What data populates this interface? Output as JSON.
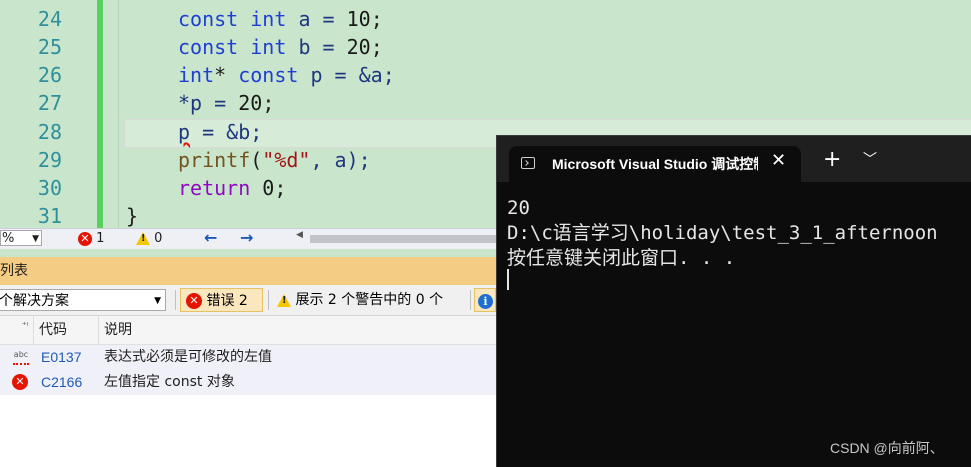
{
  "editor": {
    "lines": [
      {
        "no": "24"
      },
      {
        "no": "25"
      },
      {
        "no": "26"
      },
      {
        "no": "27"
      },
      {
        "no": "28"
      },
      {
        "no": "29"
      },
      {
        "no": "30"
      },
      {
        "no": "31"
      }
    ],
    "tokens": {
      "l24": [
        "const",
        "int",
        "a = ",
        "10",
        ";"
      ],
      "l25": [
        "const",
        "int",
        "b = ",
        "20",
        ";"
      ],
      "l26": [
        "int",
        "* ",
        "const",
        " p = &a;"
      ],
      "l27": [
        "*p = ",
        "20",
        ";"
      ],
      "l28": [
        "p",
        " = &b;"
      ],
      "l29": [
        "printf",
        "(",
        "\"%d\"",
        ", a);"
      ],
      "l30": [
        "return",
        " ",
        "0",
        ";"
      ],
      "l31": [
        "}"
      ]
    }
  },
  "status": {
    "zoom": "%",
    "errors": "1",
    "warnings": "0",
    "back_arrow": "←",
    "forward_arrow": "→"
  },
  "error_list": {
    "title": "吴列表",
    "scope": "个解决方案",
    "errors_button": "错误 2",
    "warnings_button": "展示 2 个警告中的 0 个",
    "columns": {
      "code": "代码",
      "desc": "说明"
    },
    "rows": [
      {
        "code": "E0137",
        "desc": "表达式必须是可修改的左值",
        "icon": "spell-error-icon"
      },
      {
        "code": "C2166",
        "desc": "左值指定 const 对象",
        "icon": "error-icon"
      }
    ]
  },
  "console": {
    "tab_title": "Microsoft Visual Studio 调试控制台",
    "output": [
      "20",
      "D:\\c语言学习\\holiday\\test_3_1_afternoon",
      "按任意键关闭此窗口. . ."
    ]
  },
  "watermark": "CSDN @向前阿、"
}
